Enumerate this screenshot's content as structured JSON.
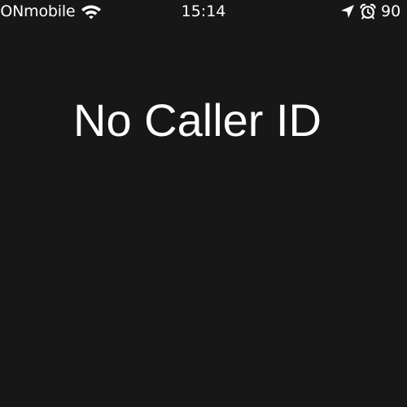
{
  "status_bar": {
    "carrier": "IONmobile",
    "time": "15:14",
    "battery_percent": "90",
    "icons": {
      "wifi": "wifi-icon",
      "location": "location-arrow-icon",
      "alarm": "alarm-clock-icon"
    }
  },
  "call": {
    "caller_label": "No Caller ID"
  },
  "colors": {
    "background": "#171717",
    "text": "#ffffff"
  }
}
